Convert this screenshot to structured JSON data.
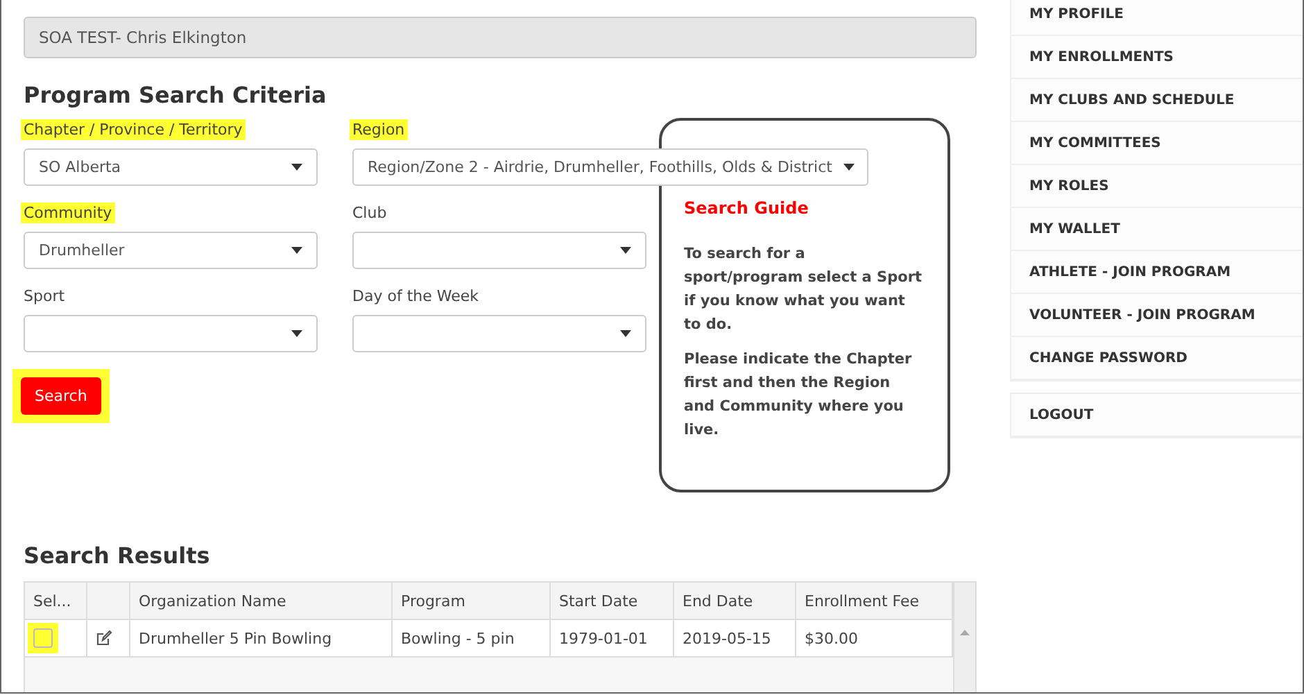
{
  "member_field": {
    "value": "SOA TEST- Chris Elkington"
  },
  "criteria": {
    "title": "Program Search Criteria",
    "fields": [
      {
        "label": "Chapter / Province / Territory",
        "value": "SO Alberta",
        "highlighted": true
      },
      {
        "label": "Region",
        "value": "Region/Zone 2 - Airdrie, Drumheller, Foothills, Olds & District",
        "highlighted": true
      },
      {
        "label": "Community",
        "value": "Drumheller",
        "highlighted": true
      },
      {
        "label": "Club",
        "highlighted": false
      },
      {
        "label": "Sport",
        "highlighted": false
      },
      {
        "label": "Day of the Week",
        "highlighted": false
      }
    ],
    "search_button": {
      "label": "Search",
      "highlighted": true
    }
  },
  "guide": {
    "title": "Search Guide",
    "paragraphs": [
      "To search for a sport/program select a Sport if you know what you want to do.",
      "Please indicate the Chapter first and then the Region and Community where you live."
    ]
  },
  "results": {
    "title": "Search Results",
    "columns": [
      "Sel...",
      "",
      "Organization Name",
      "Program",
      "Start Date",
      "End Date",
      "Enrollment Fee"
    ],
    "rows": [
      {
        "cells": [
          {
            "kind": "checkbox",
            "checked": false,
            "highlighted": true
          },
          {
            "kind": "edit"
          },
          {
            "kind": "text",
            "text": "Drumheller 5 Pin Bowling"
          },
          {
            "kind": "text",
            "text": "Bowling - 5 pin"
          },
          {
            "kind": "text",
            "text": "1979-01-01"
          },
          {
            "kind": "text",
            "text": "2019-05-15"
          },
          {
            "kind": "text",
            "text": "$30.00"
          }
        ]
      }
    ]
  },
  "sidebar": {
    "groups": [
      [
        "MY PROFILE",
        "MY ENROLLMENTS",
        "MY CLUBS AND SCHEDULE",
        "MY COMMITTEES",
        "MY ROLES",
        "MY WALLET",
        "ATHLETE - JOIN PROGRAM",
        "VOLUNTEER - JOIN PROGRAM",
        "CHANGE PASSWORD"
      ],
      [
        "LOGOUT"
      ]
    ]
  }
}
